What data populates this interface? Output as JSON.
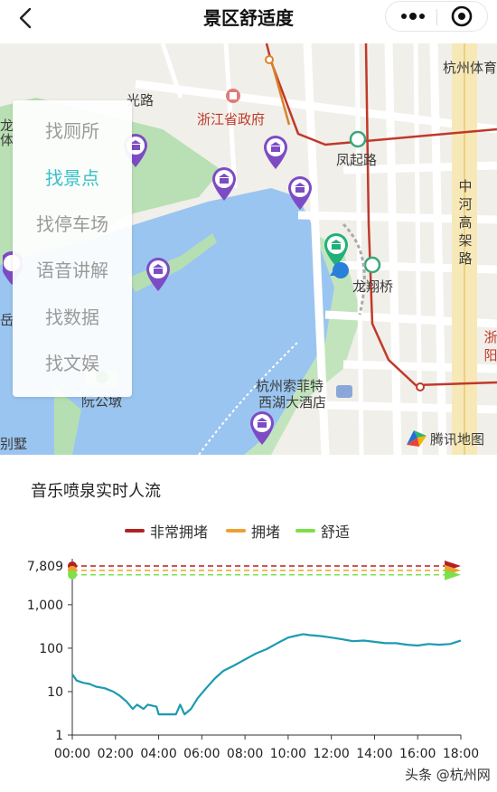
{
  "header": {
    "title": "景区舒适度",
    "icons": {
      "back": "chevron-left-icon",
      "more": "more-dots-icon",
      "close": "target-close-icon"
    }
  },
  "map": {
    "menu": [
      {
        "label": "找厕所",
        "active": false
      },
      {
        "label": "找景点",
        "active": true
      },
      {
        "label": "找停车场",
        "active": false
      },
      {
        "label": "语音讲解",
        "active": false
      },
      {
        "label": "找数据",
        "active": false
      },
      {
        "label": "找文娱",
        "active": false
      }
    ],
    "labels": {
      "government": "浙江省政府",
      "fengqi_road": "凤起路",
      "longxiang_bridge": "龙翔桥",
      "hangzhou_sports": "杭州体育",
      "ruangong_dun": "阮公墩",
      "sofitel_line1": "杭州索菲特",
      "sofitel_line2": "西湖大酒店",
      "zhonghe_viaduct": "中河高架路",
      "bieshu": "别墅",
      "road_fragment": "光路",
      "left_fragment_1": "龙",
      "left_fragment_2": "体",
      "left_fragment_3": "岳",
      "right_fragment": "浙阳",
      "provider": "腾讯地图"
    },
    "colors": {
      "water": "#9ac5f0",
      "park": "#b5dfb2",
      "metro": "#d9822b",
      "metro_dark": "#c0392b",
      "poi": "#7d4cc4",
      "poi_selected": "#22b07a"
    }
  },
  "chart": {
    "title": "音乐喷泉实时人流",
    "chart_data": {
      "type": "line",
      "scale": "log",
      "ylim": [
        1,
        7809
      ],
      "y_ticks": [
        "1",
        "10",
        "100",
        "1,000",
        "7,809"
      ],
      "x_ticks": [
        "00:00",
        "02:00",
        "04:00",
        "06:00",
        "08:00",
        "10:00",
        "12:00",
        "14:00",
        "16:00",
        "18:00"
      ],
      "thresholds": [
        {
          "name": "非常拥堵",
          "value": 7809,
          "color": "#b22222"
        },
        {
          "name": "拥堵",
          "value": 6200,
          "color": "#f0a030"
        },
        {
          "name": "舒适",
          "value": 4900,
          "color": "#7be04a"
        }
      ],
      "series": [
        {
          "color": "#1c9bb0",
          "x_hours": [
            0,
            0.2,
            0.5,
            0.8,
            1.1,
            1.5,
            1.9,
            2.2,
            2.5,
            2.8,
            3.0,
            3.3,
            3.5,
            3.9,
            4.0,
            4.3,
            4.8,
            5.0,
            5.2,
            5.5,
            5.8,
            6.2,
            6.6,
            7.0,
            7.5,
            8.0,
            8.5,
            9.0,
            9.5,
            10.0,
            10.3,
            10.7,
            11.0,
            11.5,
            12.0,
            12.5,
            13.0,
            13.5,
            14.0,
            14.5,
            15.0,
            15.5,
            16.0,
            16.5,
            17.0,
            17.5,
            18.0
          ],
          "values": [
            25,
            18,
            16,
            15,
            13,
            12,
            10,
            8,
            6,
            4,
            5,
            4,
            5,
            4.5,
            3,
            3,
            3,
            5,
            3,
            4,
            7,
            12,
            20,
            30,
            40,
            55,
            75,
            95,
            130,
            175,
            190,
            210,
            200,
            190,
            175,
            160,
            145,
            150,
            140,
            130,
            130,
            120,
            115,
            125,
            120,
            125,
            150
          ]
        }
      ]
    }
  },
  "watermark": "头条 @杭州网"
}
